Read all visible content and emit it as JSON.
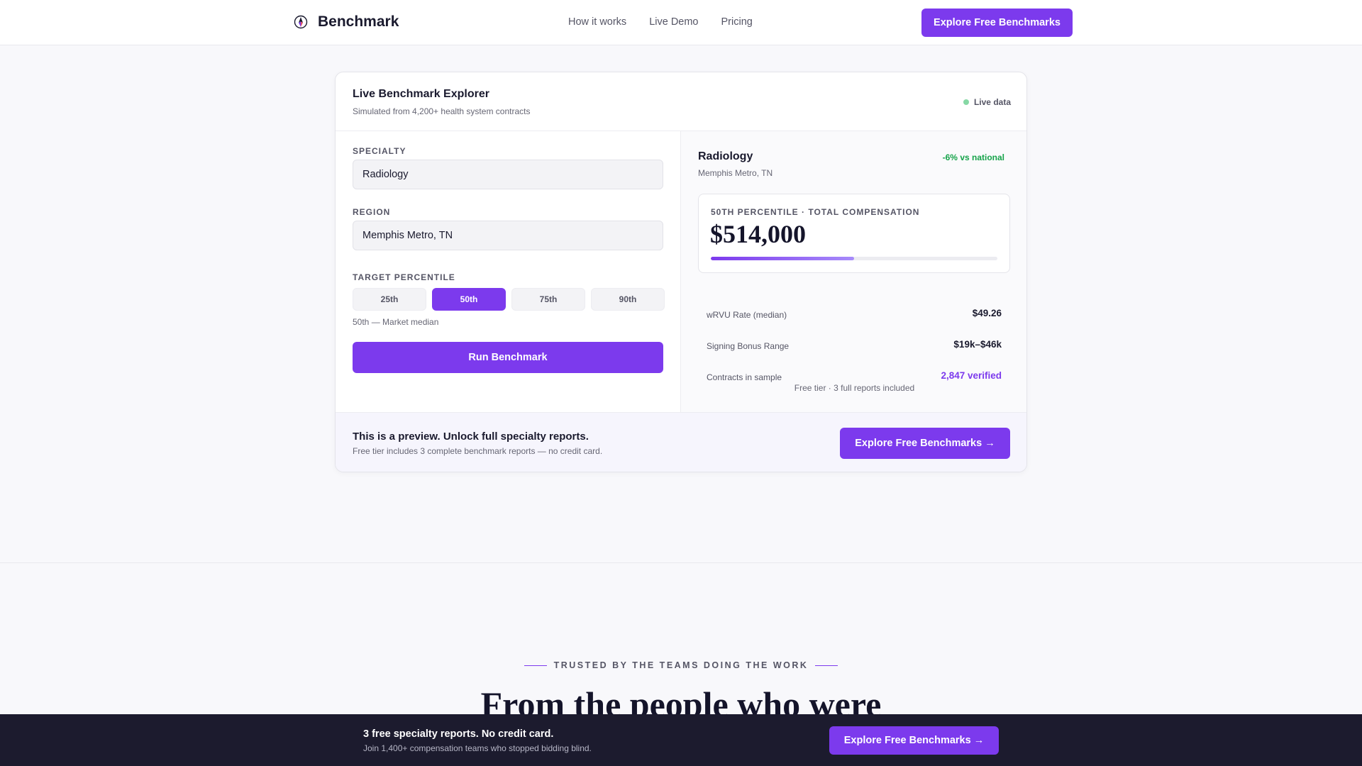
{
  "header": {
    "brand": "Benchmark",
    "brand_icon": "compass-logo-icon",
    "nav": [
      "How it works",
      "Live Demo",
      "Pricing"
    ],
    "cta": "Explore Free Benchmarks"
  },
  "explorer": {
    "title": "Live Benchmark Explorer",
    "subtitle": "Simulated from 4,200+ health system contracts",
    "live_label": "Live data",
    "live_color": "#86d8a5",
    "form": {
      "specialty_label": "SPECIALTY",
      "specialty_value": "Radiology",
      "region_label": "REGION",
      "region_value": "Memphis Metro, TN",
      "percentile_label": "TARGET PERCENTILE",
      "percentiles": [
        "25th",
        "50th",
        "75th",
        "90th"
      ],
      "selected_percentile": "50th",
      "percentile_note": "50th — Market median",
      "run_button": "Run Benchmark"
    },
    "result": {
      "specialty": "Radiology",
      "region": "Memphis Metro, TN",
      "badge": "-6% vs national",
      "badge_color": "#16a34a",
      "percentile_box_label": "50TH PERCENTILE · TOTAL COMPENSATION",
      "total_compensation": "$514,000",
      "progress_fraction": 0.5,
      "stats": [
        {
          "label": "wRVU Rate (median)",
          "value": "$49.26"
        },
        {
          "label": "Signing Bonus Range",
          "value": "$19k–$46k"
        },
        {
          "label": "Contracts in sample",
          "value": "2,847 verified"
        }
      ],
      "free_note": "Free tier · 3 full reports included"
    },
    "footer": {
      "title": "This is a preview. Unlock full specialty reports.",
      "subtitle": "Free tier includes 3 complete benchmark reports — no credit card.",
      "cta": "Explore Free Benchmarks →"
    }
  },
  "trusted": {
    "eyebrow": "TRUSTED BY THE TEAMS DOING THE WORK",
    "heading": "From the people who were"
  },
  "sticky_bar": {
    "title": "3 free specialty reports. No credit card.",
    "subtitle": "Join 1,400+ compensation teams who stopped bidding blind.",
    "cta": "Explore Free Benchmarks →"
  },
  "colors": {
    "accent": "#7c3aed",
    "sticky_bg": "#1c1b2e",
    "page_bg": "#f8f8fb"
  }
}
